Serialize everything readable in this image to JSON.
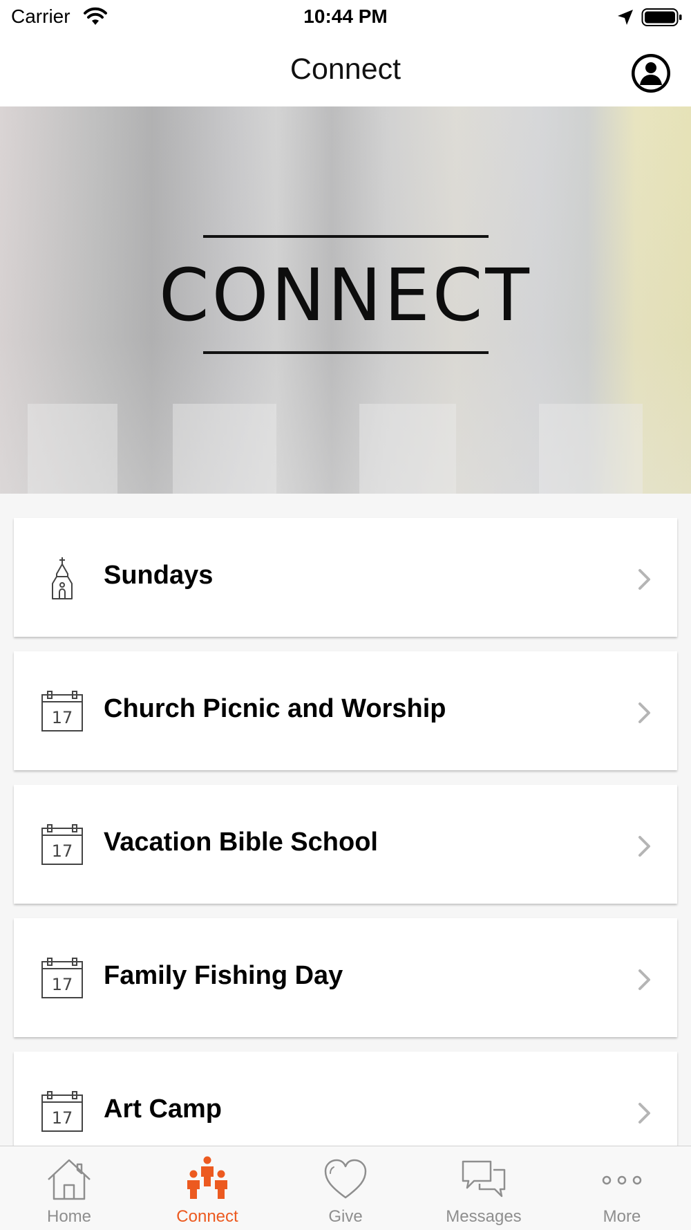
{
  "status_bar": {
    "carrier": "Carrier",
    "time": "10:44 PM"
  },
  "nav": {
    "title": "Connect"
  },
  "hero": {
    "title": "CONNECT"
  },
  "list": {
    "items": [
      {
        "label": "Sundays",
        "icon": "church-icon"
      },
      {
        "label": "Church Picnic and Worship",
        "icon": "calendar-icon",
        "day": "17"
      },
      {
        "label": "Vacation Bible School",
        "icon": "calendar-icon",
        "day": "17"
      },
      {
        "label": "Family Fishing Day",
        "icon": "calendar-icon",
        "day": "17"
      },
      {
        "label": "Art Camp",
        "icon": "calendar-icon",
        "day": "17"
      }
    ]
  },
  "tabs": {
    "items": [
      {
        "label": "Home",
        "icon": "home-icon",
        "active": false
      },
      {
        "label": "Connect",
        "icon": "people-icon",
        "active": true
      },
      {
        "label": "Give",
        "icon": "heart-icon",
        "active": false
      },
      {
        "label": "Messages",
        "icon": "chat-bubbles-icon",
        "active": false
      },
      {
        "label": "More",
        "icon": "more-dots-icon",
        "active": false
      }
    ]
  },
  "colors": {
    "accent": "#ec5a20",
    "inactive": "#8e8e8e",
    "background": "#f6f6f6"
  }
}
